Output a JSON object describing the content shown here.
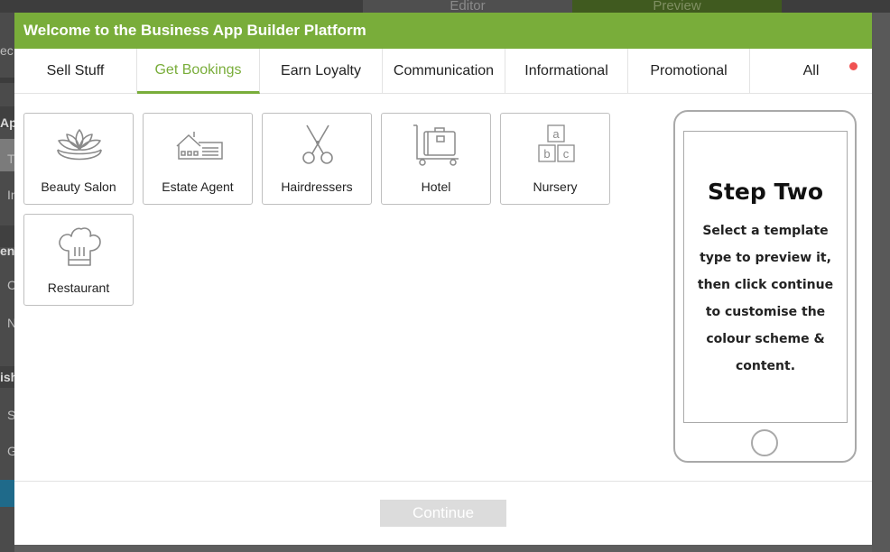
{
  "background": {
    "tabs": [
      {
        "label": "Editor"
      },
      {
        "label": "Preview"
      }
    ],
    "sidebar": [
      {
        "text": "ec"
      },
      {
        "text": "Ap"
      },
      {
        "text": "T"
      },
      {
        "text": "In"
      },
      {
        "text": "en"
      },
      {
        "text": "C"
      },
      {
        "text": "N"
      },
      {
        "text": "ish"
      },
      {
        "text": "S"
      },
      {
        "text": "G"
      }
    ]
  },
  "modal": {
    "title": "Welcome to the Business App Builder Platform",
    "tabs": [
      {
        "label": "Sell Stuff"
      },
      {
        "label": "Get Bookings",
        "active": true
      },
      {
        "label": "Earn Loyalty"
      },
      {
        "label": "Communication"
      },
      {
        "label": "Informational"
      },
      {
        "label": "Promotional"
      },
      {
        "label": "All"
      }
    ],
    "templates": [
      {
        "label": "Beauty Salon",
        "icon": "lotus-icon"
      },
      {
        "label": "Estate Agent",
        "icon": "house-icon"
      },
      {
        "label": "Hairdressers",
        "icon": "scissors-icon"
      },
      {
        "label": "Hotel",
        "icon": "luggage-trolley-icon"
      },
      {
        "label": "Nursery",
        "icon": "abc-blocks-icon"
      },
      {
        "label": "Restaurant",
        "icon": "chef-hat-icon"
      }
    ],
    "preview": {
      "title": "Step Two",
      "text": "Select a template type to preview it, then click continue to customise the colour scheme & content."
    },
    "continue_label": "Continue"
  },
  "colors": {
    "accent": "#79ad3a",
    "notification_dot": "#f05252",
    "continue_disabled": "#dcdcdc"
  }
}
